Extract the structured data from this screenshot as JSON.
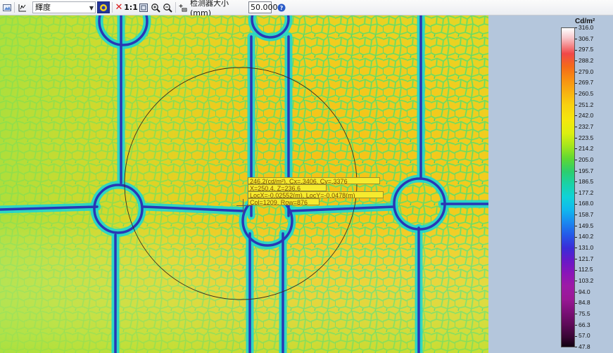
{
  "toolbar": {
    "mode_value": "輝度",
    "zoom_label": "1:1",
    "detector_label": "检测器大小 (mm)",
    "detector_size": "50.000"
  },
  "legend": {
    "unit": "Cd/m²",
    "ticks": [
      "316.0",
      "306.7",
      "297.5",
      "288.2",
      "279.0",
      "269.7",
      "260.5",
      "251.2",
      "242.0",
      "232.7",
      "223.5",
      "214.2",
      "205.0",
      "195.7",
      "186.5",
      "177.2",
      "168.0",
      "158.7",
      "149.5",
      "140.2",
      "131.0",
      "121.7",
      "112.5",
      "103.2",
      "94.0",
      "84.8",
      "75.5",
      "66.3",
      "57.0",
      "47.8"
    ]
  },
  "readout": {
    "line1": "246.2(cd/m²), Cx=.3406, Cy=.3376",
    "line2": "X=250.4, Z=236.6",
    "line3": "LocX=-0.02552(m), LocY=-0.0478(m)",
    "line4": "Col=1209, Row=876"
  },
  "colors": {
    "background_luminance": "#f4c81a",
    "line_color": "#2f3fb0",
    "panel": "#b4c6dc"
  },
  "icons": [
    "image-icon",
    "profile-icon",
    "dropdown-arrow-icon",
    "color-map-icon",
    "clear-icon",
    "fit-window-icon",
    "zoom-in-icon",
    "zoom-out-icon",
    "detector-icon",
    "help-icon"
  ]
}
